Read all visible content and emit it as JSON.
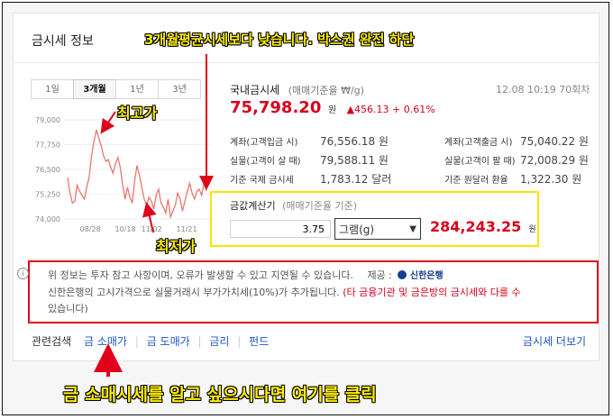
{
  "card": {
    "title": "금시세 정보"
  },
  "tabs": [
    {
      "label": "1일",
      "active": false
    },
    {
      "label": "3개월",
      "active": true
    },
    {
      "label": "1년",
      "active": false
    },
    {
      "label": "3년",
      "active": false
    }
  ],
  "chart_data": {
    "type": "line",
    "y_ticks": [
      "79,000",
      "77,750",
      "76,500",
      "75,250",
      "74,000"
    ],
    "x_ticks": [
      "08/28",
      "10/18",
      "11/02",
      "11/21"
    ],
    "ylim": [
      74000,
      79000
    ],
    "color": "#e6786f",
    "values": [
      76100,
      75300,
      74800,
      74900,
      75700,
      75400,
      75200,
      75000,
      75600,
      76100,
      77200,
      77900,
      78500,
      78100,
      77700,
      77200,
      76900,
      77000,
      76600,
      76300,
      76800,
      77100,
      76600,
      75700,
      75000,
      75600,
      75100,
      74800,
      75900,
      76700,
      76200,
      75600,
      75000,
      74700,
      75100,
      74900,
      74500,
      75200,
      75500,
      74800,
      74600,
      74300,
      75000,
      74100,
      74400,
      74700,
      75300,
      75000,
      74400,
      74900,
      75400,
      75800,
      75300,
      75000,
      75400,
      75500,
      75200,
      75800,
      75400
    ]
  },
  "price": {
    "label": "국내금시세",
    "basis": "(매매기준율 ₩/g)",
    "date": "12.08 10:19 70회차",
    "value": "75,798.20",
    "unit": "원",
    "change": "▲456.13 + 0.61%"
  },
  "details": {
    "left": [
      {
        "label": "계좌(고객입금 시)",
        "value": "76,556.18 원"
      },
      {
        "label": "실물(고객이 살 때)",
        "value": "79,588.11 원"
      },
      {
        "label": "기준 국제 금시세",
        "value": "1,783.12 달러"
      }
    ],
    "right": [
      {
        "label": "계좌(고객출금 시)",
        "value": "75,040.22 원"
      },
      {
        "label": "실물(고객이 팔 때)",
        "value": "72,008.29 원"
      },
      {
        "label": "기준 원달러 환율",
        "value": "1,322.30 원"
      }
    ]
  },
  "calc": {
    "title": "금값계산기",
    "basis": "(매매기준율 기준)",
    "input_value": "3.75",
    "unit_selected": "그램(g)",
    "result": "284,243.25",
    "result_unit": "원"
  },
  "notice": {
    "line1": "위 정보는 투자 참고 사항이며, 오류가 발생할 수 있고 지연될 수 있습니다.",
    "provider_label": "제공 :",
    "provider_name": "신한은행",
    "line2a": "신한은행의 고시가격으로 실물거래시 부가가치세(10%)가 추가됩니다.",
    "line2b": "(타 금융기관 및 금은방의 금시세와 다를 수",
    "line3": "있습니다)"
  },
  "related": {
    "label": "관련검색",
    "links": [
      "금 소매가",
      "금 도매가",
      "금리",
      "펀드"
    ],
    "more": "금시세 더보기"
  },
  "annotations": {
    "top": "3개월평균시세보다 낮습니다. 박스권 완전 하단",
    "high": "최고가",
    "low": "최저가",
    "bottom": "금 소매시세를 알고 싶으시다면 여기를 클릭"
  }
}
